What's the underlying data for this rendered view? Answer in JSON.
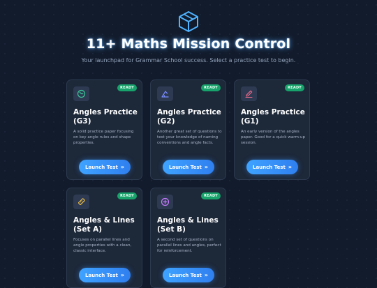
{
  "header": {
    "title": "11+ Maths Mission Control",
    "subtitle": "Your launchpad for Grammar School success. Select a practice test to begin."
  },
  "cards": [
    {
      "title": "Angles Practice (G3)",
      "desc": "A solid practice paper focusing on key angle rules and shape properties.",
      "badge": "READY",
      "button": "Launch Test",
      "icon": "angle-circle-icon",
      "icon_color": "#3cc79a"
    },
    {
      "title": "Angles Practice (G2)",
      "desc": "Another great set of questions to test your knowledge of naming conventions and angle facts.",
      "badge": "READY",
      "button": "Launch Test",
      "icon": "protractor-icon",
      "icon_color": "#7b8cff"
    },
    {
      "title": "Angles Practice (G1)",
      "desc": "An early version of the angles paper. Good for a quick warm-up session.",
      "badge": "READY",
      "button": "Launch Test",
      "icon": "pencil-icon",
      "icon_color": "#f06a8a"
    },
    {
      "title": "Angles & Lines (Set A)",
      "desc": "Focuses on parallel lines and angle properties with a clean, classic interface.",
      "badge": "READY",
      "button": "Launch Test",
      "icon": "ruler-icon",
      "icon_color": "#f2c14a"
    },
    {
      "title": "Angles & Lines (Set B)",
      "desc": "A second set of questions on parallel lines and angles, perfect for reinforcement.",
      "badge": "READY",
      "button": "Launch Test",
      "icon": "plus-circle-icon",
      "icon_color": "#c77cff"
    }
  ],
  "colors": {
    "accent": "#3fa3ff",
    "ready": "#17a36b",
    "background": "#121b2b",
    "card": "#1d2839"
  }
}
